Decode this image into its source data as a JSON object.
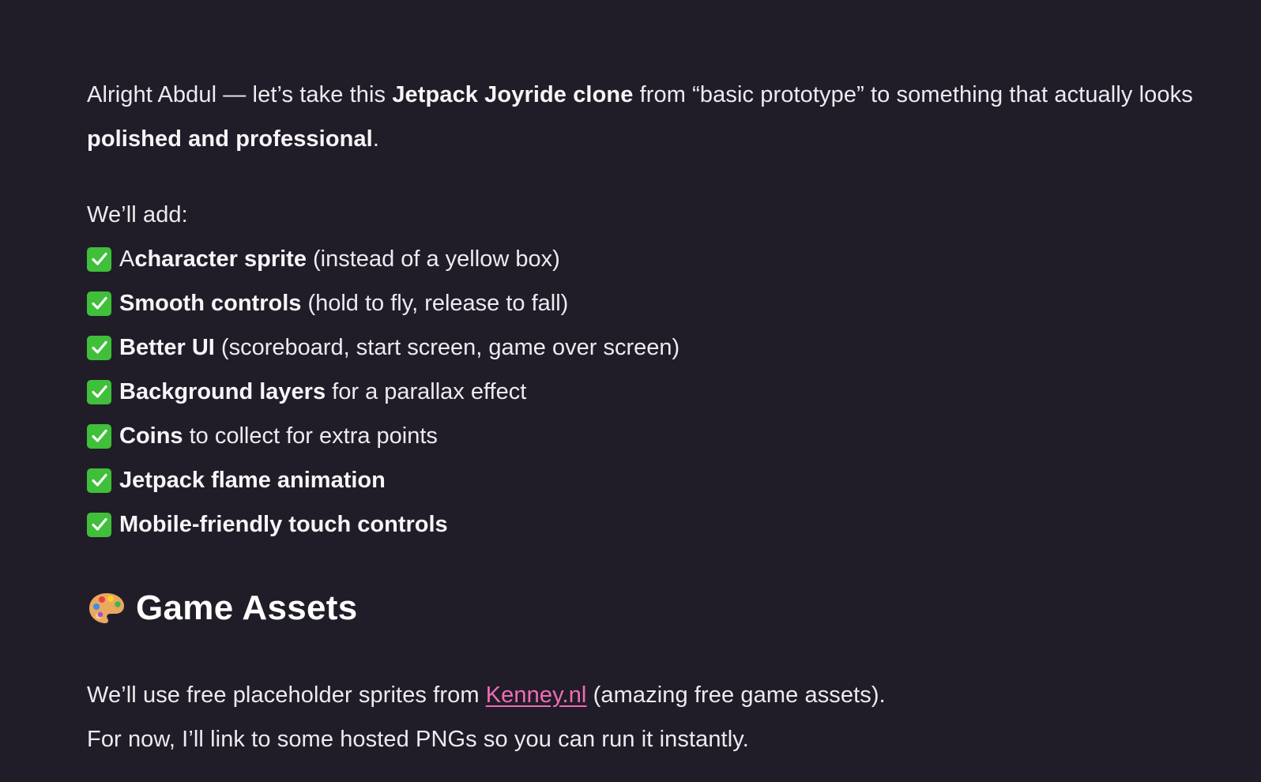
{
  "intro": {
    "part1": "Alright Abdul — let’s take this ",
    "bold1": "Jetpack Joyride clone",
    "part2": " from “basic prototype” to something that actually looks ",
    "bold2": "polished and professional",
    "part3": "."
  },
  "add_heading": "We’ll add:",
  "features": [
    {
      "pre": "A ",
      "bold": "character sprite",
      "rest": " (instead of a yellow box)"
    },
    {
      "pre": "",
      "bold": "Smooth controls",
      "rest": " (hold to fly, release to fall)"
    },
    {
      "pre": "",
      "bold": "Better UI",
      "rest": " (scoreboard, start screen, game over screen)"
    },
    {
      "pre": "",
      "bold": "Background layers",
      "rest": " for a parallax effect"
    },
    {
      "pre": "",
      "bold": "Coins",
      "rest": " to collect for extra points"
    },
    {
      "pre": "",
      "bold": "Jetpack flame animation",
      "rest": ""
    },
    {
      "pre": "",
      "bold": "Mobile-friendly touch controls",
      "rest": ""
    }
  ],
  "section": {
    "icon": "artist-palette-icon",
    "title": "Game Assets"
  },
  "assets": {
    "line1_pre": "We’ll use free placeholder sprites from ",
    "link_text": "Kenney.nl",
    "line1_post": " (amazing free game assets).",
    "line2": "For now, I’ll link to some hosted PNGs so you can run it instantly."
  },
  "colors": {
    "background": "#211d28",
    "text": "#ecebef",
    "link": "#f06db6",
    "check": "#3fbf3a"
  }
}
